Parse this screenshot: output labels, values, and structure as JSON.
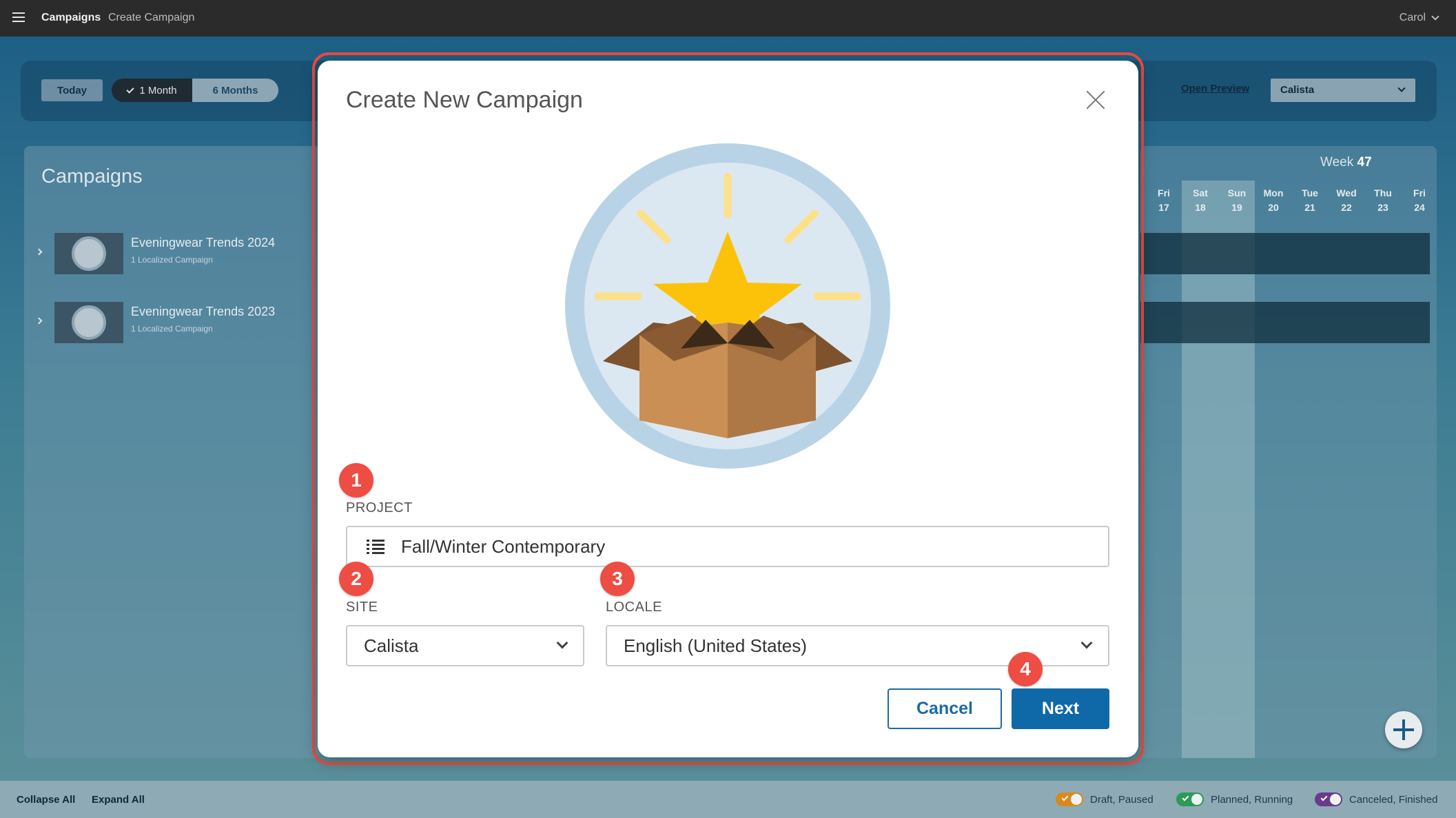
{
  "topbar": {
    "crumbs": [
      "Campaigns",
      "Create Campaign"
    ],
    "user": "Carol"
  },
  "toolbar": {
    "today": "Today",
    "range_options": [
      "1 Month",
      "6 Months"
    ],
    "range_selected": "1 Month",
    "open_preview": "Open Preview",
    "site_value": "Calista"
  },
  "campaigns": {
    "title": "Campaigns",
    "items": [
      {
        "name": "Eveningwear Trends 2024",
        "sub": "1 Localized Campaign"
      },
      {
        "name": "Eveningwear Trends 2023",
        "sub": "1 Localized Campaign"
      }
    ]
  },
  "calendar": {
    "week_prefix": "Week",
    "week_number": "47",
    "days": [
      {
        "dow": "Fri",
        "date": "17"
      },
      {
        "dow": "Sat",
        "date": "18"
      },
      {
        "dow": "Sun",
        "date": "19"
      },
      {
        "dow": "Mon",
        "date": "20"
      },
      {
        "dow": "Tue",
        "date": "21"
      },
      {
        "dow": "Wed",
        "date": "22"
      },
      {
        "dow": "Thu",
        "date": "23"
      },
      {
        "dow": "Fri",
        "date": "24"
      }
    ]
  },
  "bottombar": {
    "collapse_all": "Collapse All",
    "expand_all": "Expand All",
    "legend": [
      {
        "label": "Draft, Paused",
        "color": "#d9891c"
      },
      {
        "label": "Planned, Running",
        "color": "#2f9a56"
      },
      {
        "label": "Canceled, Finished",
        "color": "#6a3a8c"
      }
    ]
  },
  "modal": {
    "title": "Create New Campaign",
    "project_label": "PROJECT",
    "project_value": "Fall/Winter Contemporary",
    "site_label": "SITE",
    "site_value": "Calista",
    "locale_label": "LOCALE",
    "locale_value": "English (United States)",
    "cancel": "Cancel",
    "next": "Next"
  },
  "badges": [
    "1",
    "2",
    "3",
    "4"
  ],
  "colors": {
    "accent": "#0f68a8",
    "badge": "#ee4d43",
    "star": "#fcc20a",
    "box": "#c98f55"
  }
}
